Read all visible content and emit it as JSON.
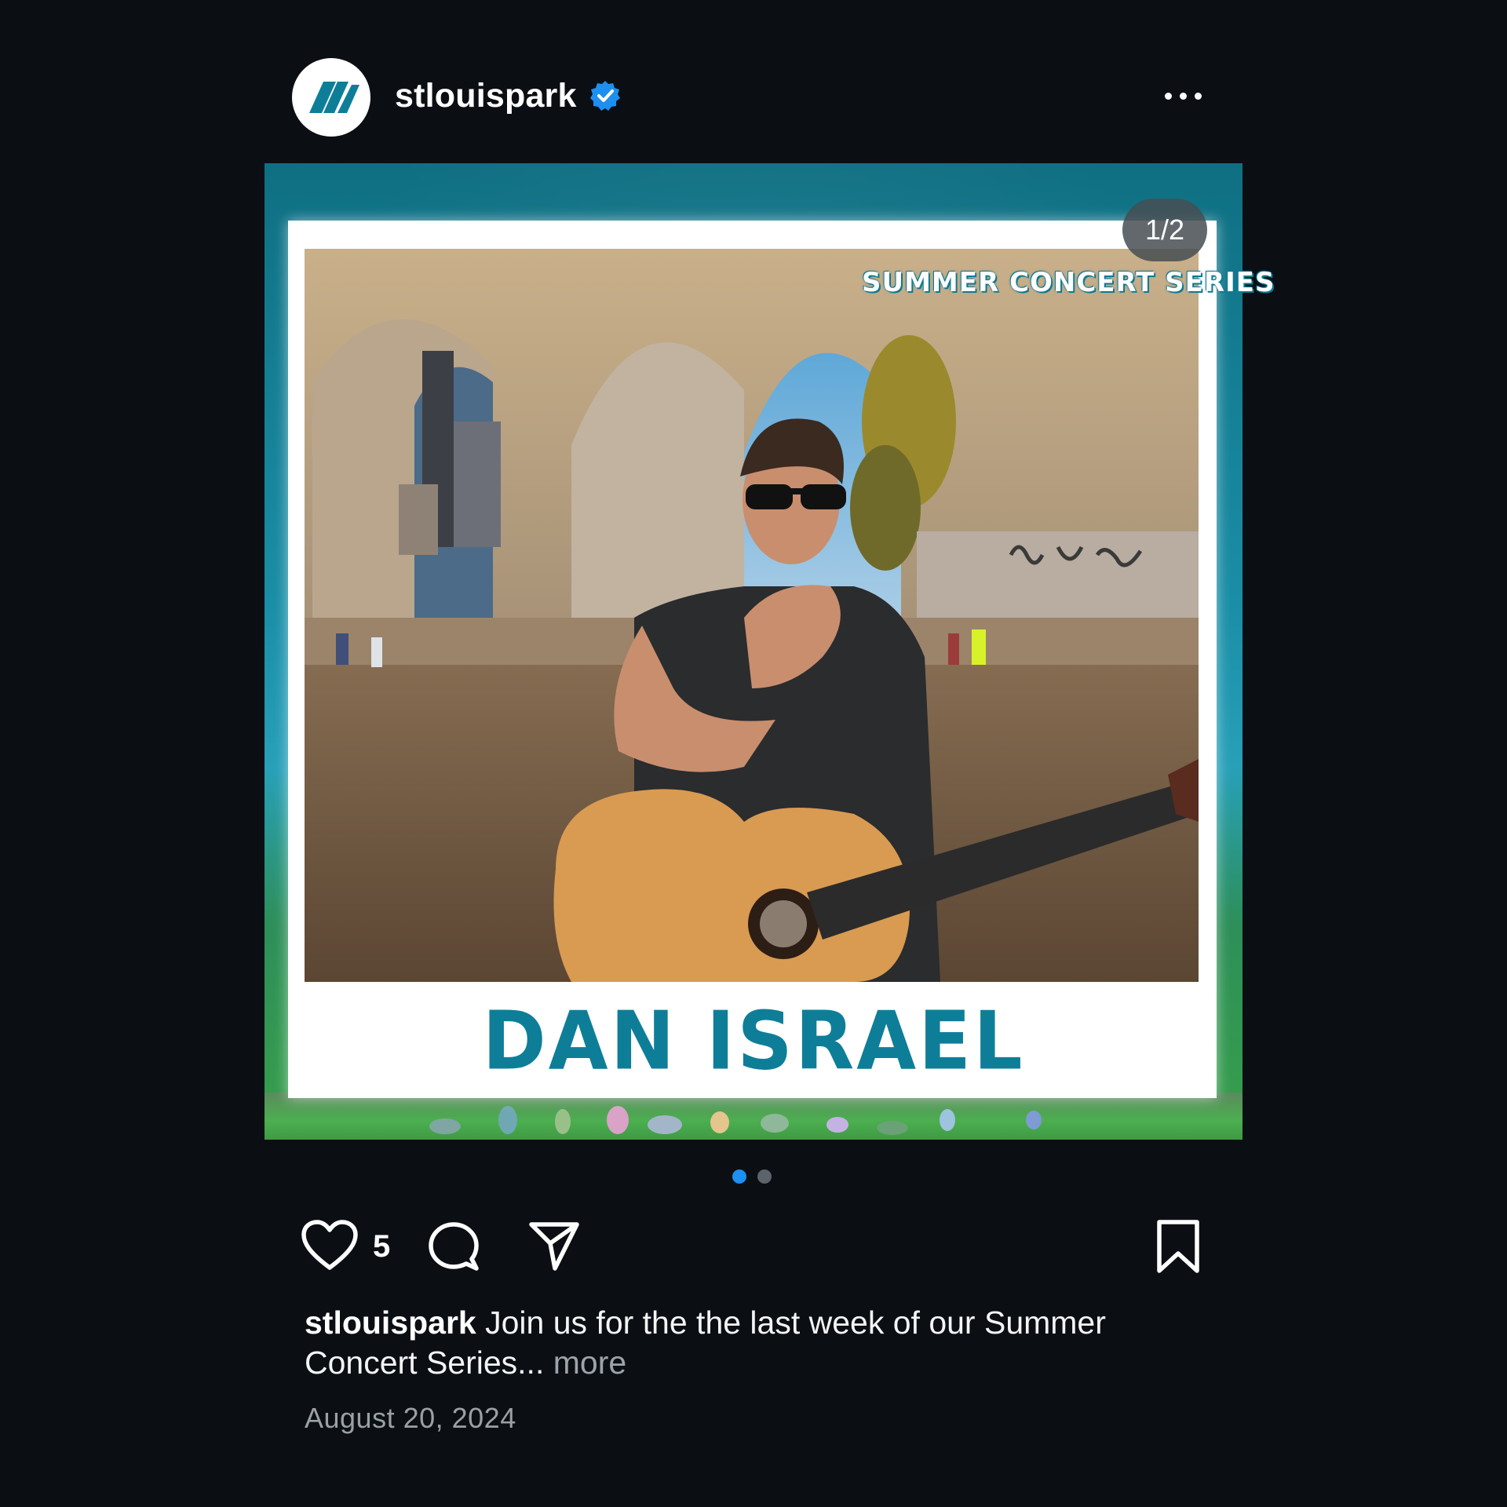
{
  "header": {
    "username": "stlouispark",
    "verified": true,
    "more_icon": "more-horizontal-icon"
  },
  "media": {
    "counter": "1/2",
    "series_title": "SUMMER CONCERT SERIES",
    "artist_name": "DAN ISRAEL",
    "carousel_total": 2,
    "carousel_active": 1
  },
  "actions": {
    "like_icon": "heart-icon",
    "like_count": "5",
    "comment_icon": "comment-icon",
    "share_icon": "send-icon",
    "save_icon": "bookmark-icon"
  },
  "caption": {
    "username": "stlouispark",
    "text": " Join us for the the last week of our Summer Concert Series...",
    "more_label": " more"
  },
  "date": "August 20, 2024",
  "colors": {
    "background": "#0b0f14",
    "verified_blue": "#1d8ff0",
    "active_dot": "#1d8ff0",
    "brand_teal": "#0e7e98"
  }
}
